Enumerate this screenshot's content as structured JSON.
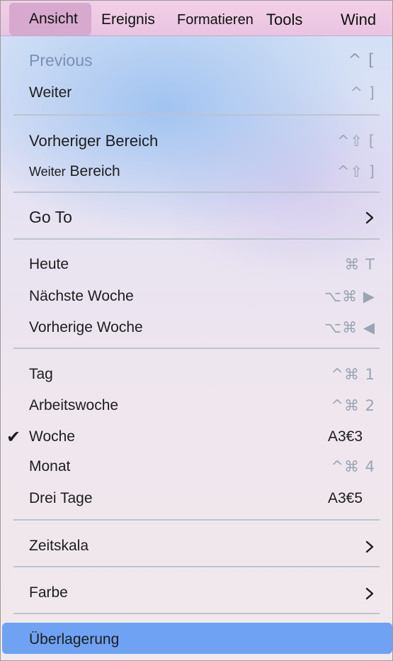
{
  "menubar": {
    "items": [
      {
        "label": "Ansicht"
      },
      {
        "label": "Ereignis"
      },
      {
        "label": "Formatieren"
      },
      {
        "label": "Tools"
      },
      {
        "label": "Wind"
      }
    ]
  },
  "menu": {
    "previous": {
      "label": "Previous",
      "shortcut": "^ ["
    },
    "weiter": {
      "label": "Weiter",
      "shortcut": "^ ]"
    },
    "vorheriger_bereich": {
      "label": "Vorheriger Bereich",
      "shortcut": "^⇧ ["
    },
    "weiter_bereich": {
      "label_a": "Weiter",
      "label_b": "Bereich",
      "shortcut": "^⇧ ]"
    },
    "go_to": {
      "label": "Go To"
    },
    "heute": {
      "label": "Heute",
      "shortcut": "⌘ T"
    },
    "naechste_woche": {
      "label": "Nächste Woche",
      "shortcut": "⌥⌘ ▶"
    },
    "vorherige_woche": {
      "label": "Vorherige Woche",
      "shortcut": "⌥⌘ ◀"
    },
    "tag": {
      "label": "Tag",
      "shortcut": "^⌘ 1"
    },
    "arbeitswoche": {
      "label": "Arbeitswoche",
      "shortcut": "^⌘ 2"
    },
    "woche": {
      "label": "Woche",
      "shortcut": "A3€3",
      "check": "✔"
    },
    "monat": {
      "label": "Monat",
      "shortcut": "^⌘ 4"
    },
    "drei_tage": {
      "label": "Drei Tage",
      "shortcut": "A3€5"
    },
    "zeitskala": {
      "label": "Zeitskala"
    },
    "farbe": {
      "label": "Farbe"
    },
    "ueberlagerung": {
      "label": "Überlagerung"
    }
  },
  "colors": {
    "menubar": "#e9c4e2",
    "selected_item": "#6fa2f2",
    "disabled_text": "#7d8fb2",
    "shortcut_text": "#9aa4b3"
  }
}
